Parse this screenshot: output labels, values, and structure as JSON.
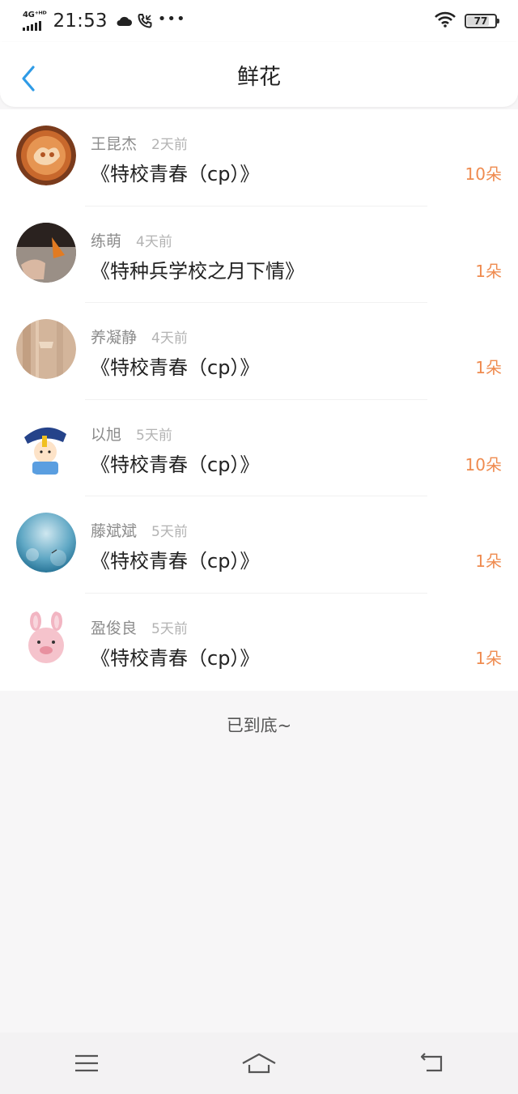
{
  "status_bar": {
    "network": "4G⁺ᴴᴰ",
    "time": "21:53",
    "battery": "77",
    "icons": [
      "cloud-icon",
      "phone-icon",
      "more-dots-icon",
      "wifi-icon",
      "battery-icon"
    ]
  },
  "header": {
    "title": "鲜花",
    "back_icon": "chevron-left-icon"
  },
  "list": {
    "items": [
      {
        "name": "王昆杰",
        "time": "2天前",
        "book": "《特校青春（cp）》",
        "count": "10朵"
      },
      {
        "name": "练萌",
        "time": "4天前",
        "book": "《特种兵学校之月下情》",
        "count": "1朵"
      },
      {
        "name": "养凝静",
        "time": "4天前",
        "book": "《特校青春（cp）》",
        "count": "1朵"
      },
      {
        "name": "以旭",
        "time": "5天前",
        "book": "《特校青春（cp）》",
        "count": "10朵"
      },
      {
        "name": "藤斌斌",
        "time": "5天前",
        "book": "《特校青春（cp）》",
        "count": "1朵"
      },
      {
        "name": "盈俊良",
        "time": "5天前",
        "book": "《特校青春（cp）》",
        "count": "1朵"
      }
    ]
  },
  "end_text": "已到底~",
  "navbar": {
    "icons": [
      "menu-icon",
      "home-icon",
      "back-icon"
    ]
  },
  "colors": {
    "accent_blue": "#2f9be6",
    "count_orange": "#ef8b4f",
    "page_bg": "#f7f6f7"
  }
}
